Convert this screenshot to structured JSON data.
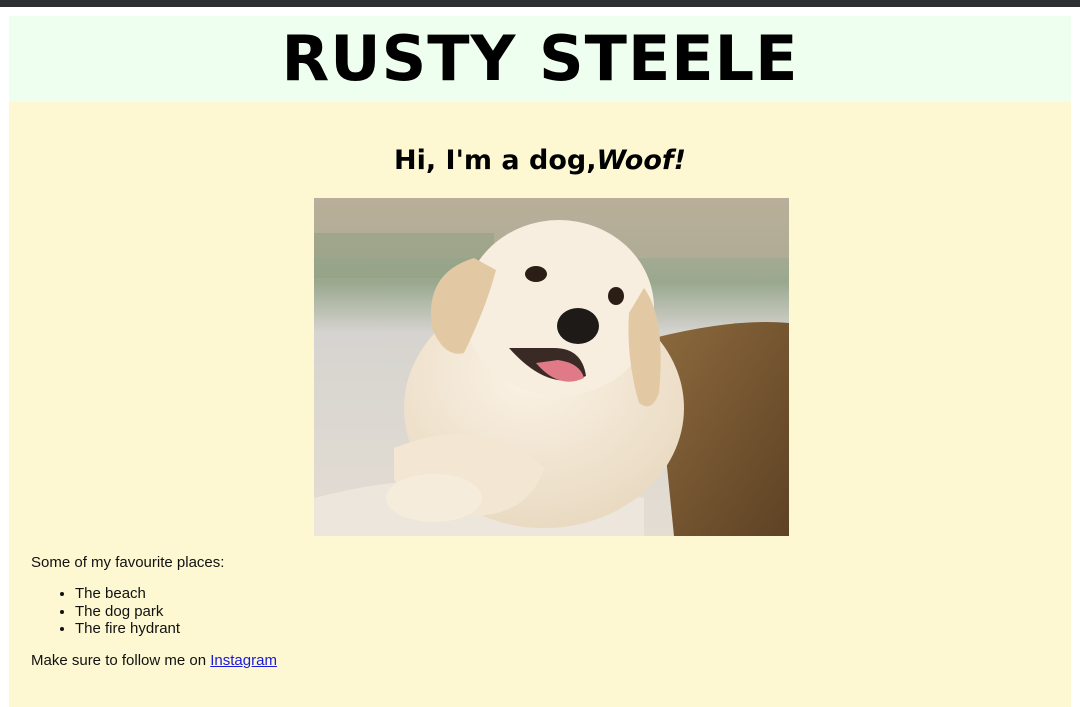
{
  "header": {
    "title": "RUSTY STEELE"
  },
  "main": {
    "greeting": "Hi, I'm a dog,",
    "greeting_emphasis": "Woof!",
    "photo_alt": "Puppy",
    "places_intro": "Some of my favourite places:",
    "places": [
      "The beach",
      "The dog park",
      "The fire hydrant"
    ],
    "follow_text": "Make sure to follow me on ",
    "follow_link": "Instagram"
  },
  "colors": {
    "header_bg": "#eefeef",
    "main_bg": "#fdf8d1",
    "link": "#1a1ad8",
    "topbar": "#2e2f33"
  }
}
